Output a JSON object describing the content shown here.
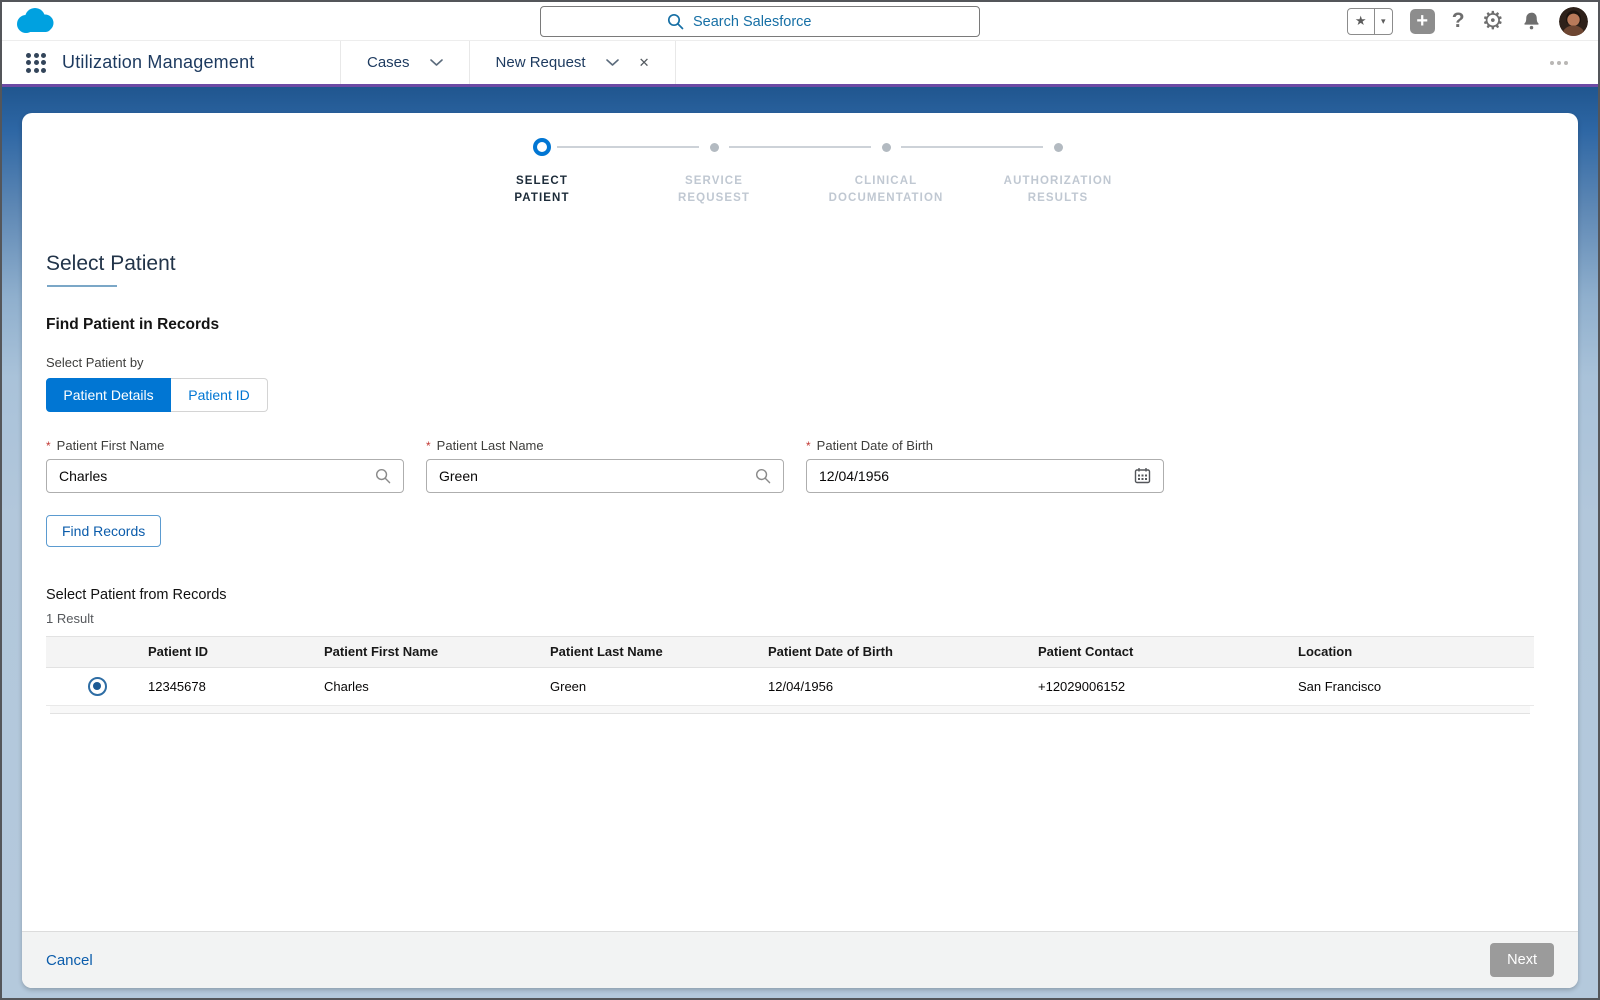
{
  "colors": {
    "brand_blue": "#0176d3",
    "navy_text": "#1d3a5f",
    "accent_purple": "#6d4aa4",
    "banner_blue": "#20568f",
    "page_bg_blue": "#b2c7db",
    "link_blue": "#0b5cab",
    "logo_blue": "#00a1e0",
    "required_red": "#c23934",
    "disabled_gray": "#9b9b9b"
  },
  "icons": {
    "star_glyph": "★",
    "caret_glyph": "▾",
    "plus_glyph": "+",
    "help_glyph": "?",
    "gear_glyph": "⚙",
    "close_glyph": "✕"
  },
  "global_header": {
    "search_placeholder": "Search Salesforce"
  },
  "nav": {
    "app_name": "Utilization Management",
    "tabs": [
      {
        "label": "Cases"
      },
      {
        "label": "New Request"
      }
    ]
  },
  "stepper": {
    "steps": [
      {
        "label": "SELECT\nPATIENT",
        "state": "active"
      },
      {
        "label": "SERVICE\nREQUSEST",
        "state": "upcoming"
      },
      {
        "label": "CLINICAL\nDOCUMENTATION",
        "state": "upcoming"
      },
      {
        "label": "AUTHORIZATION\nRESULTS",
        "state": "upcoming"
      }
    ]
  },
  "main": {
    "page_title": "Select Patient",
    "section_title": "Find Patient in Records",
    "select_by_label": "Select Patient by",
    "required_marker": "*",
    "toggle": [
      {
        "label": "Patient Details",
        "active": true
      },
      {
        "label": "Patient ID",
        "active": false
      }
    ],
    "fields": [
      {
        "label": "Patient First Name",
        "value": "Charles",
        "required": true,
        "icon": "search-icon"
      },
      {
        "label": "Patient Last Name",
        "value": "Green",
        "required": true,
        "icon": "search-icon"
      },
      {
        "label": "Patient Date of Birth",
        "value": "12/04/1956",
        "required": true,
        "icon": "calendar-icon"
      }
    ],
    "find_records_button": "Find Records",
    "results": {
      "title": "Select Patient from Records",
      "count_text": "1 Result",
      "columns": [
        "Patient ID",
        "Patient First Name",
        "Patient Last Name",
        "Patient Date of Birth",
        "Patient Contact",
        "Location"
      ],
      "rows": [
        {
          "selected": true,
          "patient_id": "12345678",
          "first_name": "Charles",
          "last_name": "Green",
          "date_of_birth": "12/04/1956",
          "contact": "+12029006152",
          "location": "San Francisco"
        }
      ]
    }
  },
  "footer": {
    "cancel_label": "Cancel",
    "next_label": "Next",
    "next_disabled": true
  }
}
